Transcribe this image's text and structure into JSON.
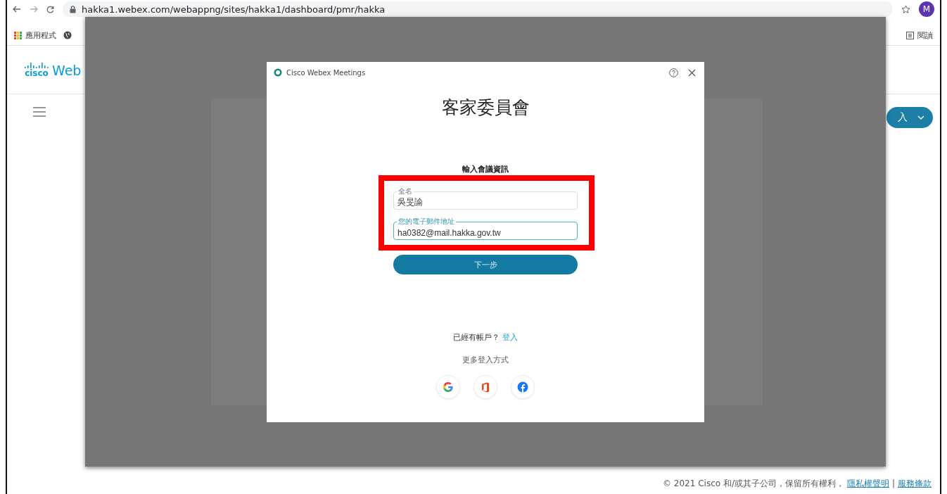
{
  "browser": {
    "url": "hakka1.webex.com/webappng/sites/hakka1/dashboard/pmr/hakka",
    "avatar": "M",
    "bookmarks": [
      {
        "label": "應用程式"
      }
    ],
    "bookmarks_right": [
      {
        "label": "閱讀"
      }
    ]
  },
  "page": {
    "logo_mark": "cisco",
    "logo_text": "Web",
    "sign_in_button": "入"
  },
  "dialog": {
    "title": "Cisco Webex Meetings",
    "heading": "客家委員會",
    "section_title": "輸入會議資訊",
    "fields": [
      {
        "label": "全名",
        "value": "吳旻諭",
        "focused": false
      },
      {
        "label": "您的電子郵件地址",
        "value": "ha0382@mail.hakka.gov.tw",
        "focused": true
      }
    ],
    "next_button": "下一步",
    "account_prompt": "已經有帳戶？",
    "sign_in_link": "登入",
    "more_options": "更多登入方式",
    "providers": [
      {
        "kind": "google"
      },
      {
        "kind": "office"
      },
      {
        "kind": "facebook"
      }
    ]
  },
  "footer": {
    "copyright": "© 2021 Cisco 和/或其子公司，保留所有權利，",
    "links": [
      "隱私權聲明",
      "服務條款"
    ],
    "divider": "|"
  }
}
